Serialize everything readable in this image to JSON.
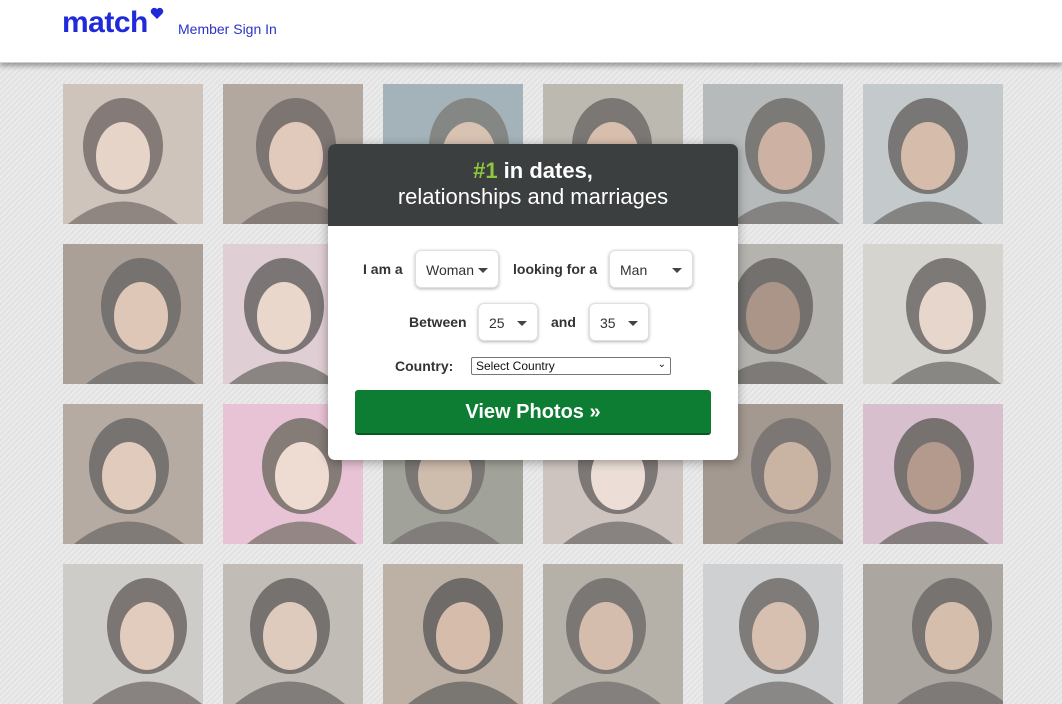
{
  "header": {
    "logo_text": "match",
    "sign_in_label": "Member Sign In"
  },
  "colors": {
    "brand_blue": "#1f2ad8",
    "accent_green": "#8dc63f",
    "button_green": "#0c7d33",
    "panel_header": "#3c3f3f"
  },
  "panel": {
    "rank": "#1",
    "headline_rest": " in dates,",
    "subheadline": "relationships and marriages",
    "i_am_label": "I am a",
    "i_am_value": "Woman",
    "looking_label": "looking for a",
    "looking_value": "Man",
    "between_label": "Between",
    "age_min": "25",
    "and_label": "and",
    "age_max": "35",
    "country_label": "Country:",
    "country_value": "Select Country",
    "cta_label": "View Photos »"
  },
  "photo_grid": {
    "rows": 4,
    "columns": 6,
    "description": "member profile photos"
  }
}
